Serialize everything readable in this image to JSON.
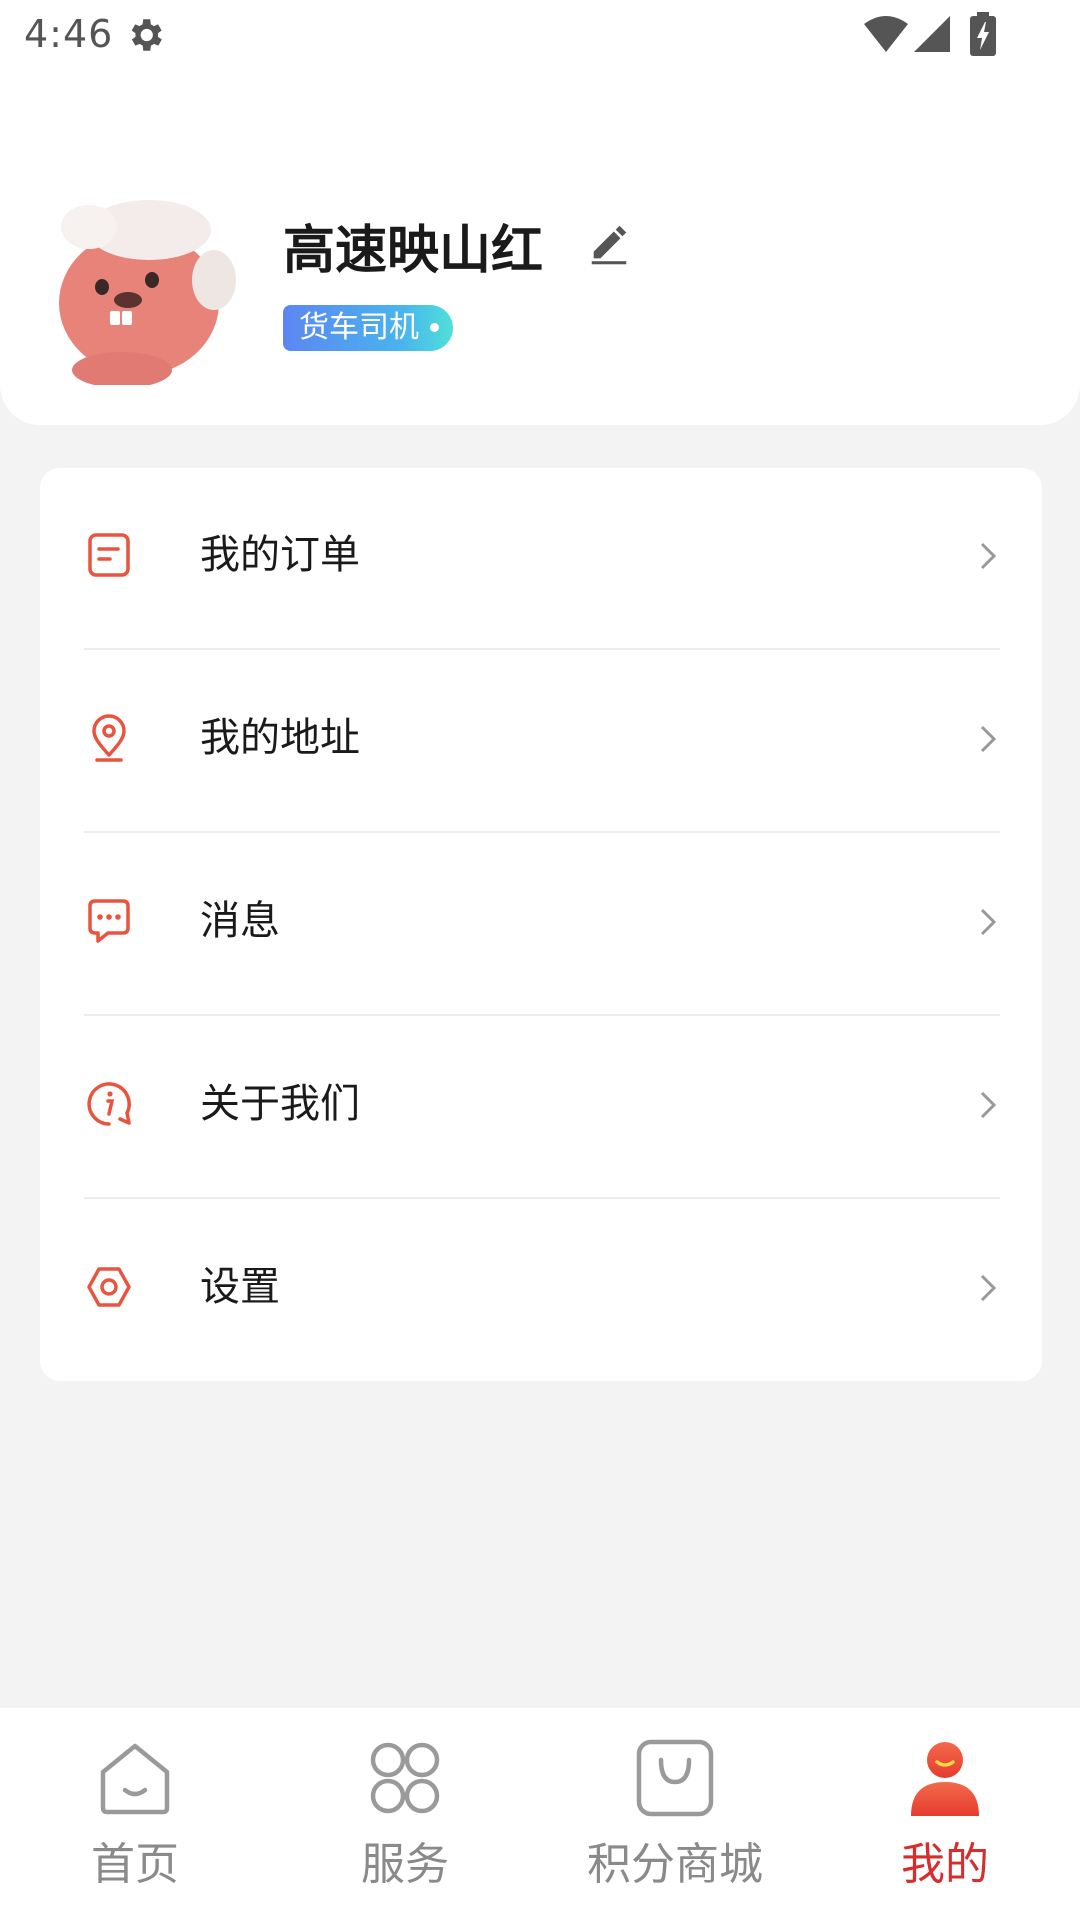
{
  "status_bar": {
    "time": "4:46",
    "icons": [
      "gear-icon",
      "wifi-icon",
      "signal-icon",
      "battery-charging-icon"
    ]
  },
  "profile": {
    "username": "高速映山红",
    "role_badge": "货车司机",
    "avatar_icon": "cartoon-beaver-avatar",
    "edit_icon": "pencil-icon"
  },
  "menu": {
    "items": [
      {
        "label": "我的订单",
        "icon": "order-document-icon"
      },
      {
        "label": "我的地址",
        "icon": "location-pin-icon"
      },
      {
        "label": "消息",
        "icon": "message-bubble-icon"
      },
      {
        "label": "关于我们",
        "icon": "info-icon"
      },
      {
        "label": "设置",
        "icon": "settings-hexagon-icon"
      }
    ]
  },
  "bottom_nav": {
    "items": [
      {
        "label": "首页",
        "icon": "home-icon",
        "active": false
      },
      {
        "label": "服务",
        "icon": "services-grid-icon",
        "active": false
      },
      {
        "label": "积分商城",
        "icon": "shopping-bag-icon",
        "active": false
      },
      {
        "label": "我的",
        "icon": "profile-person-icon",
        "active": true
      }
    ]
  },
  "colors": {
    "accent": "#e8543e",
    "active_nav": "#d62d2d",
    "badge_gradient_start": "#5c86f2",
    "badge_gradient_end": "#4fe0d8",
    "page_background": "#f3f3f3"
  }
}
